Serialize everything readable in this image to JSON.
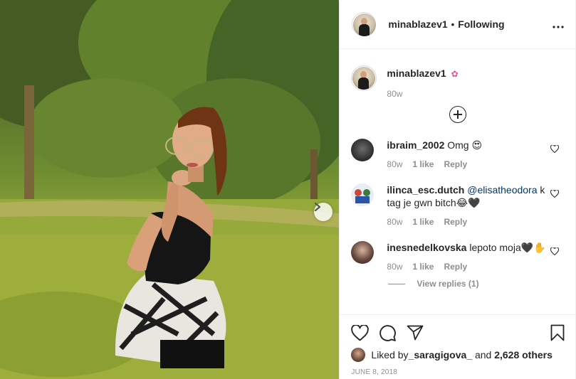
{
  "post": {
    "author": "minablazev1",
    "follow_state": "Following",
    "more_label": "•••",
    "caption_emoji": "✿",
    "caption_time": "80w",
    "likes_prefix": "Liked by ",
    "liked_by_user": "_saragigova_",
    "likes_and": " and ",
    "likes_others": "2,628 others",
    "date": "JUNE 8, 2018"
  },
  "comments": [
    {
      "user": "ibraim_2002",
      "text": " Omg 😍",
      "time": "80w",
      "likes": "1 like",
      "reply": "Reply",
      "avatar_color": "#2b2b2b"
    },
    {
      "user": "ilinca_esc.dutch",
      "mention": " @elisatheodora",
      "text": " k tag je gwn bitch😂🖤",
      "time": "80w",
      "likes": "1 like",
      "reply": "Reply",
      "avatar_color": "#d8e4ef"
    },
    {
      "user": "inesnedelkovska",
      "text": " lepoto moja🖤✋",
      "time": "80w",
      "likes": "1 like",
      "reply": "Reply",
      "avatar_color": "#3a2a26",
      "view_replies": "View replies (1)"
    }
  ],
  "colors": {
    "text": "#262626",
    "muted": "#8e8e8e",
    "border": "#efefef",
    "link": "#00376b"
  },
  "icons": [
    "heart-icon",
    "comment-icon",
    "share-icon",
    "bookmark-icon",
    "chevron-right-icon",
    "plus-circle-icon",
    "more-icon"
  ]
}
